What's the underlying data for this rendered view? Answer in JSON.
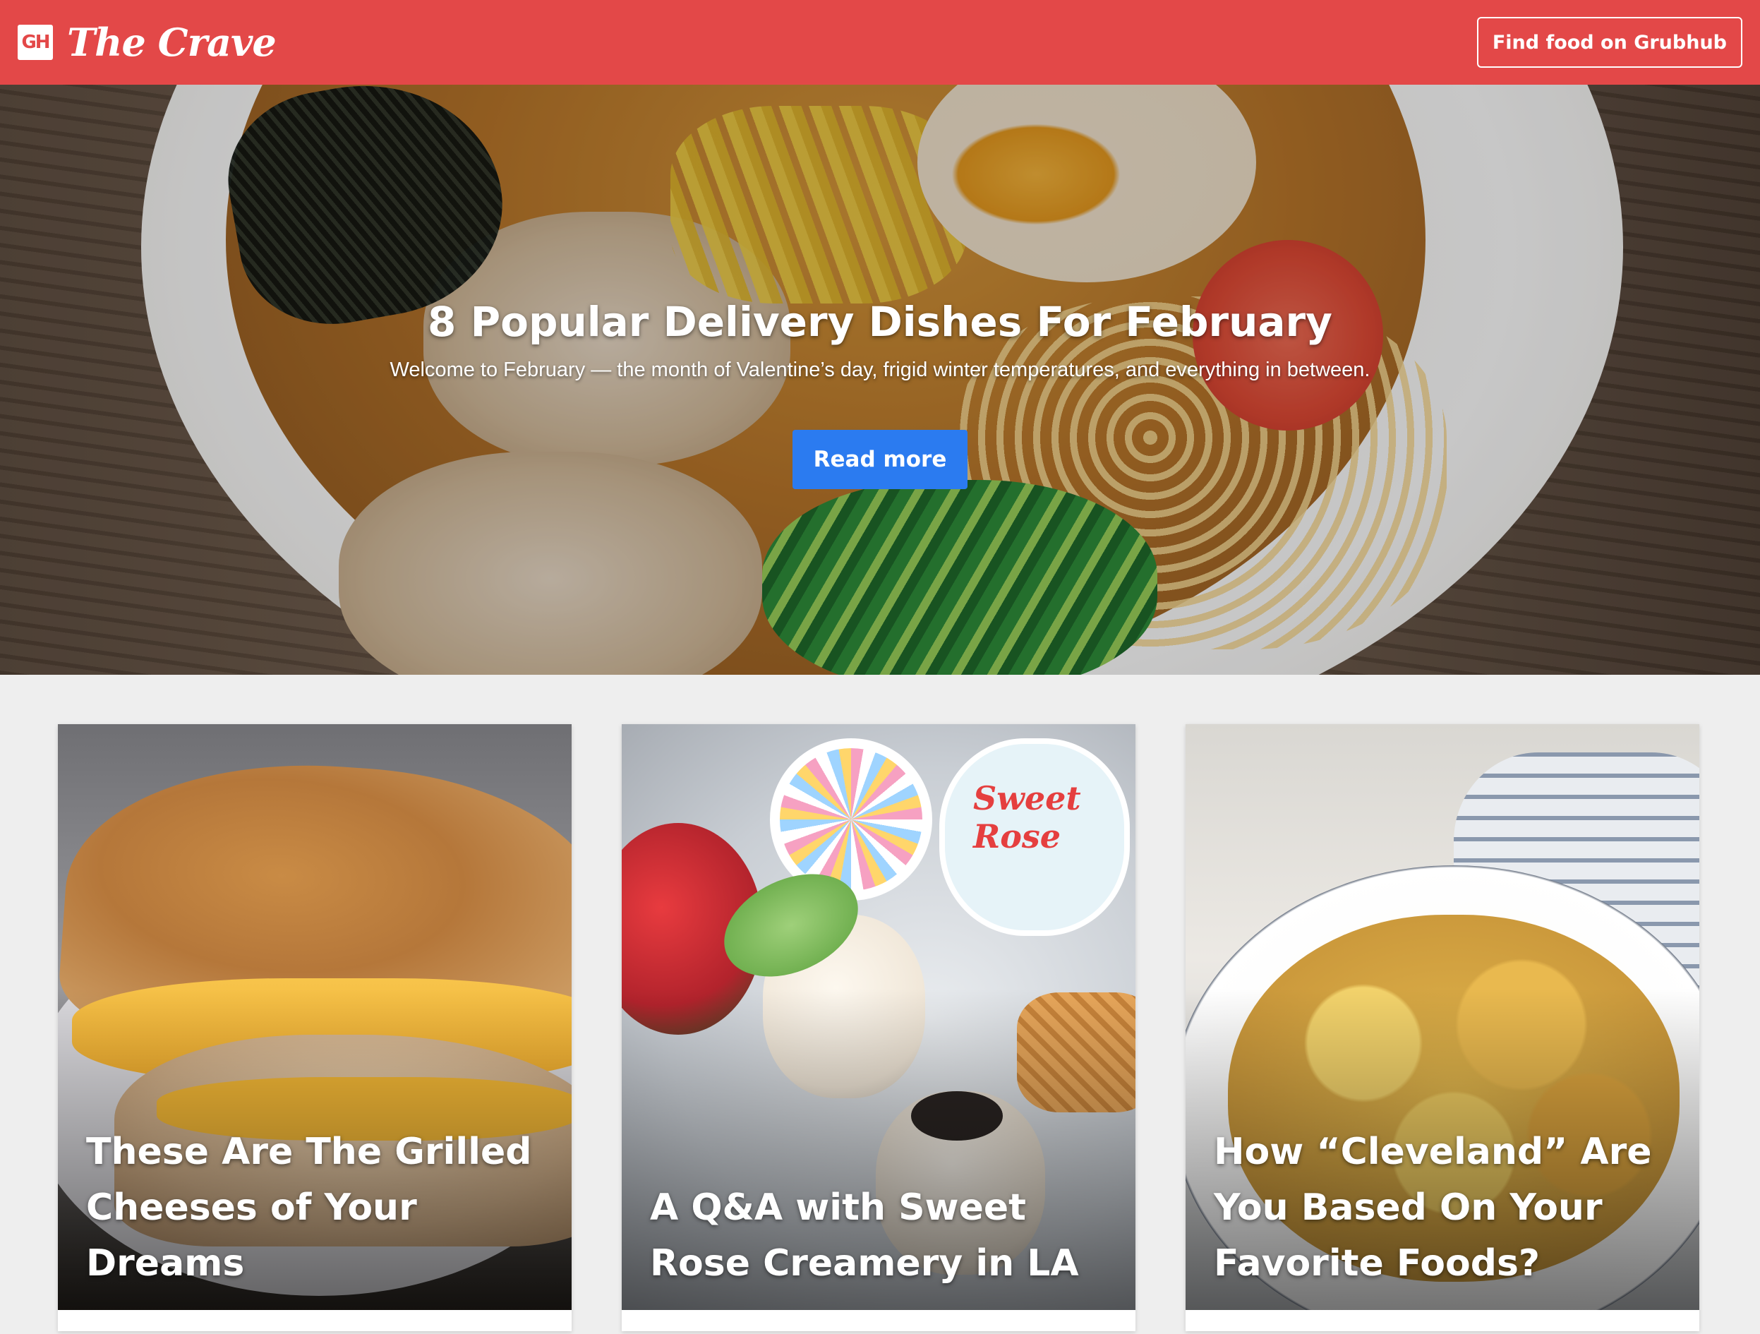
{
  "topbar": {
    "logo_text": "GH",
    "brand_name": "The Crave",
    "find_food_label": "Find food on Grubhub",
    "bg_color": "#e34848"
  },
  "hero": {
    "title": "8 Popular Delivery Dishes For February",
    "subtitle": "Welcome to February — the month of Valentine’s day, frigid winter temperatures, and everything in between.",
    "read_more_label": "Read more",
    "button_color": "#2b7bf0"
  },
  "cards": [
    {
      "title": "These Are The Grilled Cheeses of Your Dreams"
    },
    {
      "title": "A Q&A with Sweet Rose Creamery in LA"
    },
    {
      "title": "How “Cleveland” Are You Based On Your Favorite Foods?"
    }
  ],
  "card2_image": {
    "tub_brand_text": "Sweet Rose"
  }
}
